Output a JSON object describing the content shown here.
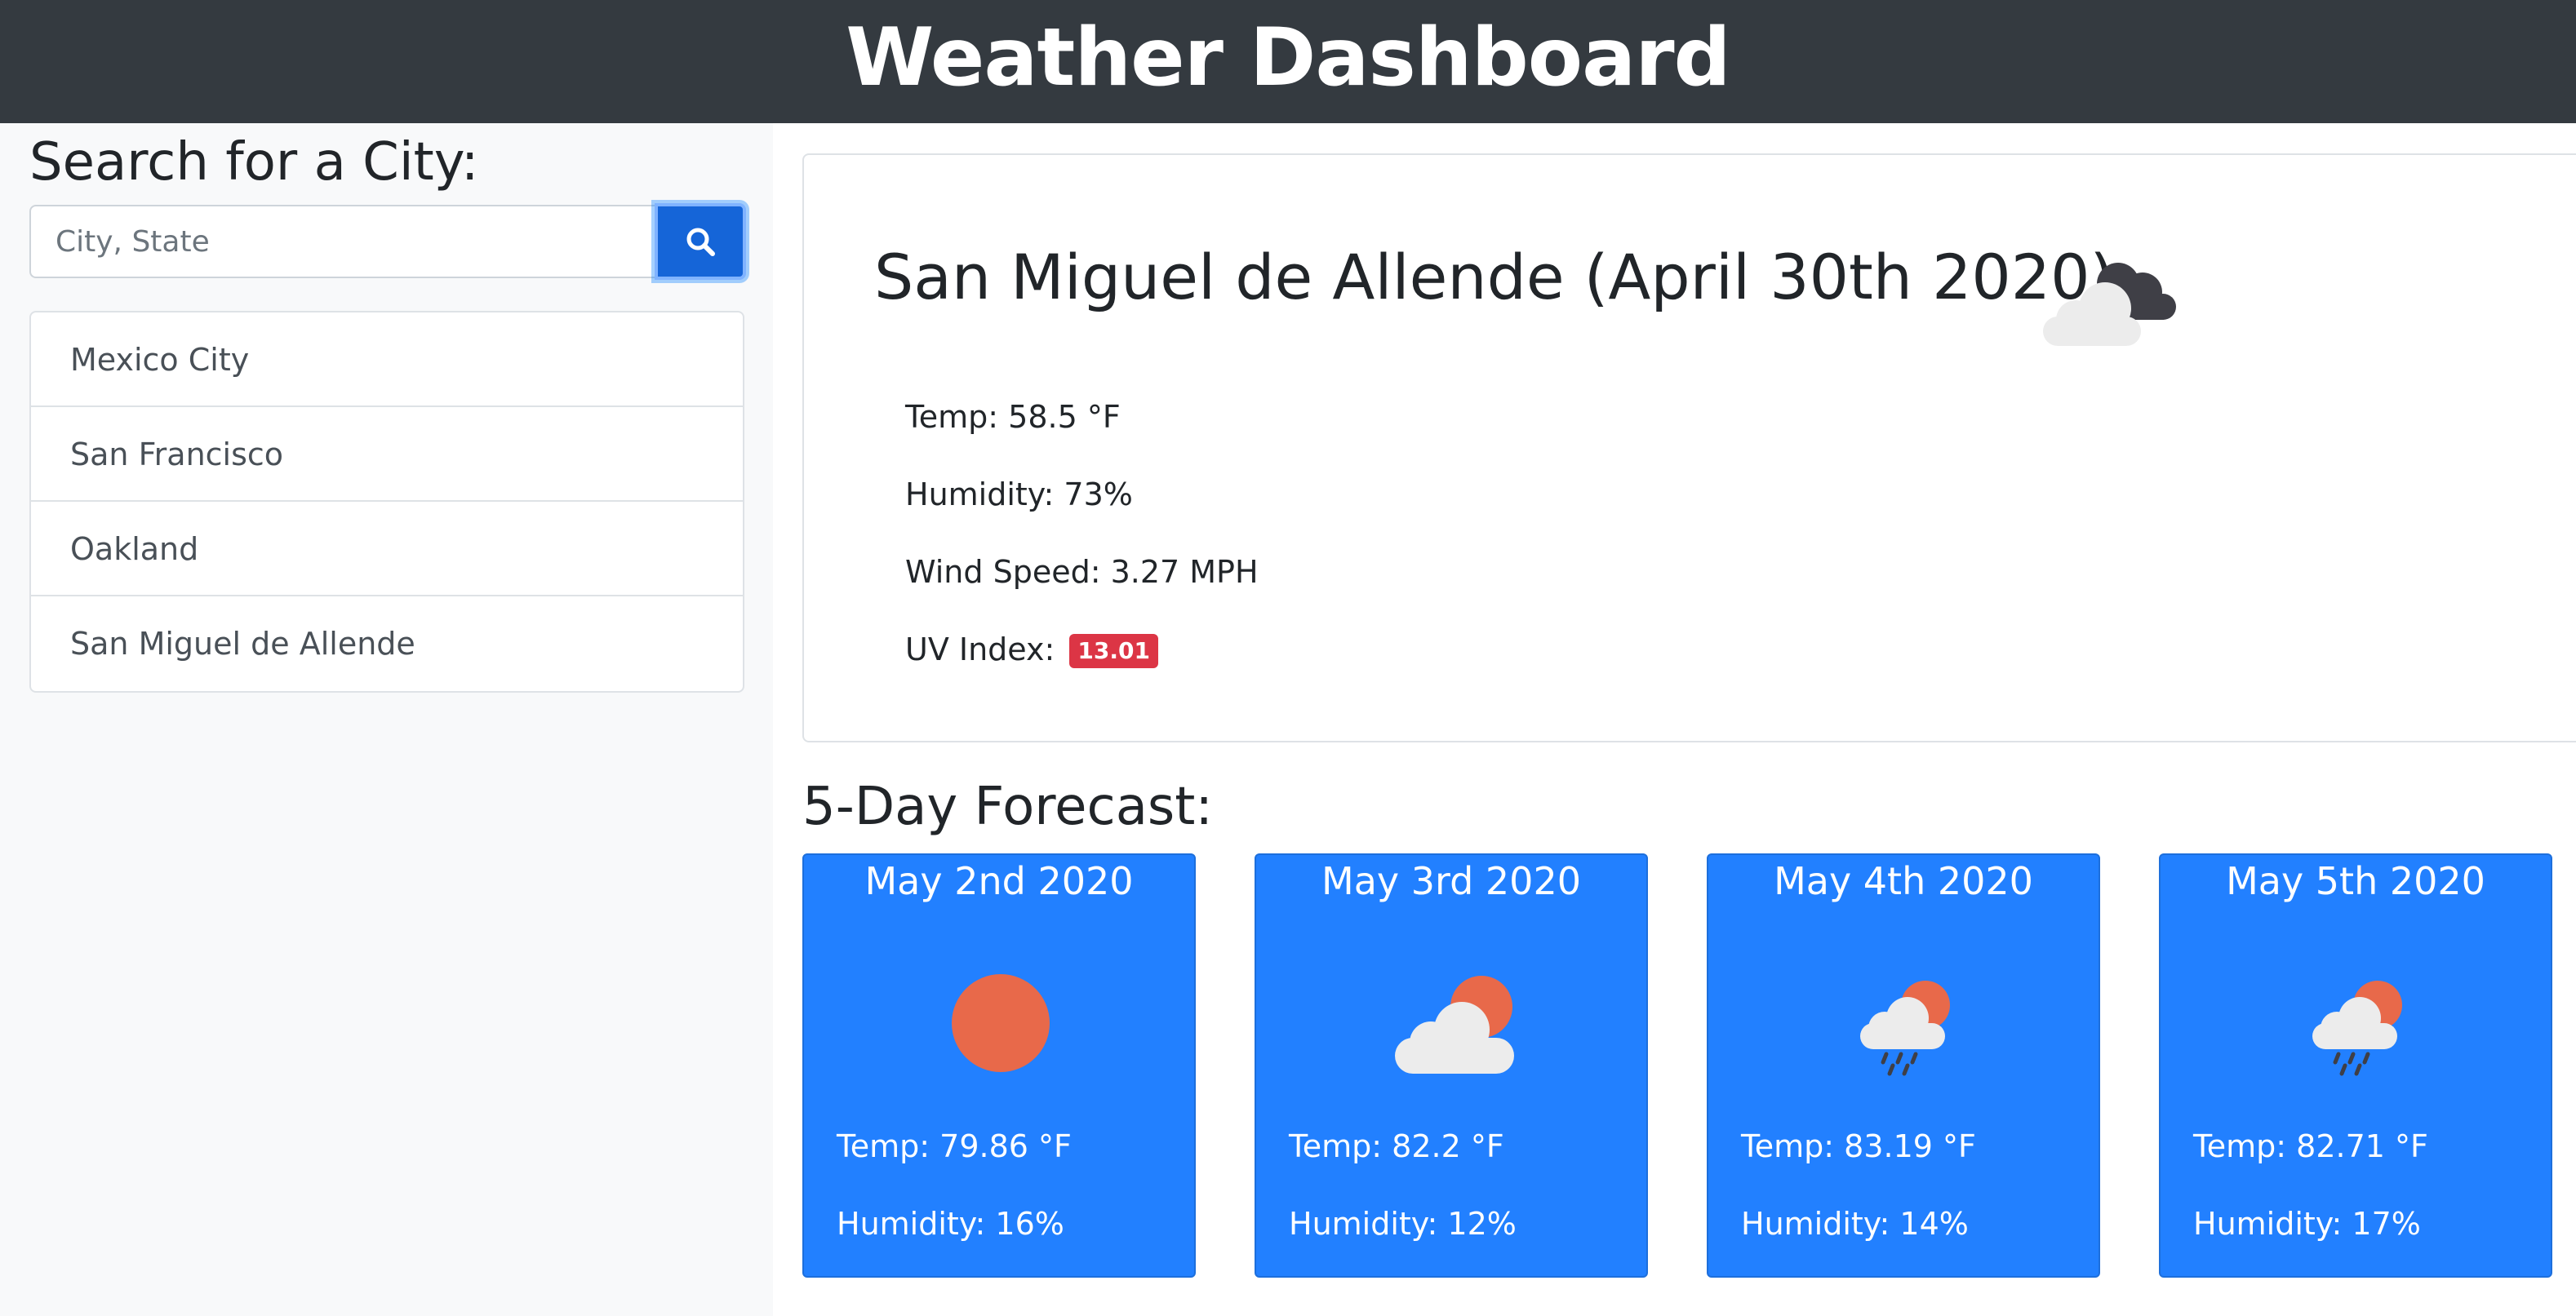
{
  "header": {
    "title": "Weather Dashboard"
  },
  "sidebar": {
    "title": "Search for a City:",
    "search": {
      "placeholder": "City, State",
      "value": ""
    },
    "cities": [
      "Mexico City",
      "San Francisco",
      "Oakland",
      "San Miguel de Allende"
    ]
  },
  "current": {
    "title": "San Miguel de Allende (April 30th 2020)",
    "icon": "cloud-broken-icon",
    "temp": "Temp: 58.5 °F",
    "humidity": "Humidity: 73%",
    "wind": "Wind Speed: 3.27 MPH",
    "uv_label": "UV Index:",
    "uv_value": "13.01",
    "uv_color": "#dc3545"
  },
  "forecast": {
    "heading": "5-Day Forecast:",
    "days": [
      {
        "date": "May 2nd 2020",
        "icon": "sun-icon",
        "temp": "Temp: 79.86 °F",
        "humidity": "Humidity: 16%"
      },
      {
        "date": "May 3rd 2020",
        "icon": "partly-cloudy-icon",
        "temp": "Temp: 82.2 °F",
        "humidity": "Humidity: 12%"
      },
      {
        "date": "May 4th 2020",
        "icon": "rain-sun-icon",
        "temp": "Temp: 83.19 °F",
        "humidity": "Humidity: 14%"
      },
      {
        "date": "May 5th 2020",
        "icon": "rain-sun-icon",
        "temp": "Temp: 82.71 °F",
        "humidity": "Humidity: 17%"
      }
    ]
  },
  "colors": {
    "header_bg": "#343a40",
    "sidebar_bg": "#f8f9fa",
    "forecast_card_bg": "#2280ff",
    "search_button_bg": "#1565d8",
    "sun": "#e8694a"
  }
}
